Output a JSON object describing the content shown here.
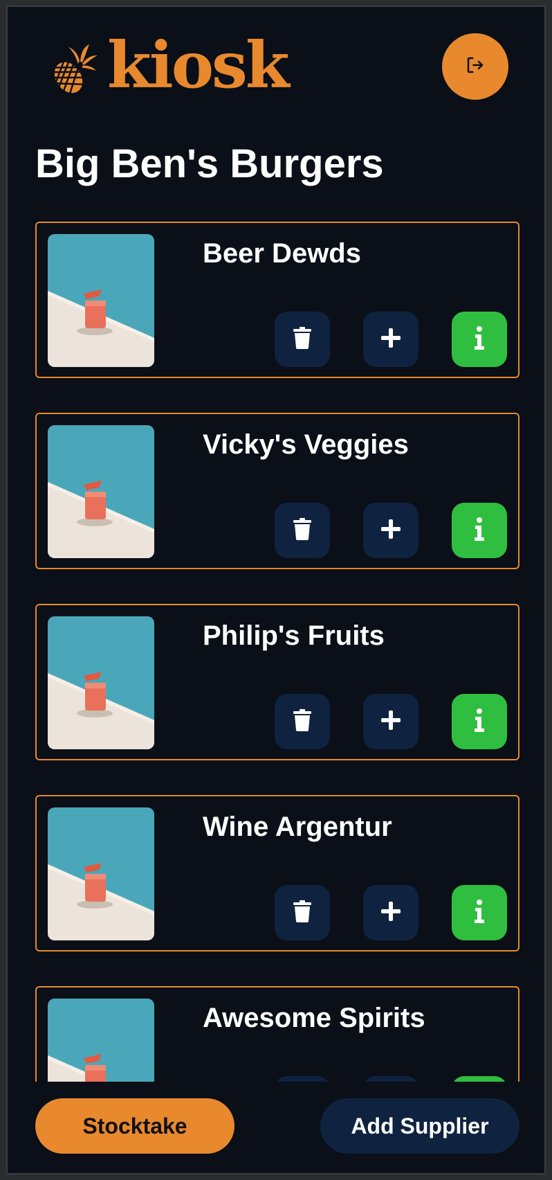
{
  "app": {
    "logo_text": "kiosk",
    "accent_color": "#e8892e",
    "icons": {
      "logo": "pineapple-icon",
      "logout": "logout-icon"
    }
  },
  "page": {
    "title": "Big Ben's Burgers"
  },
  "suppliers": [
    {
      "name": "Beer Dewds"
    },
    {
      "name": "Vicky's Veggies"
    },
    {
      "name": "Philip's Fruits"
    },
    {
      "name": "Wine Argentur"
    },
    {
      "name": "Awesome Spirits"
    }
  ],
  "card_actions": {
    "icons": [
      "trash-icon",
      "plus-icon",
      "info-icon"
    ],
    "colors": {
      "delete": "#0f2340",
      "add": "#0f2340",
      "info": "#2fbe3f"
    }
  },
  "footer": {
    "stocktake_label": "Stocktake",
    "add_supplier_label": "Add Supplier"
  }
}
